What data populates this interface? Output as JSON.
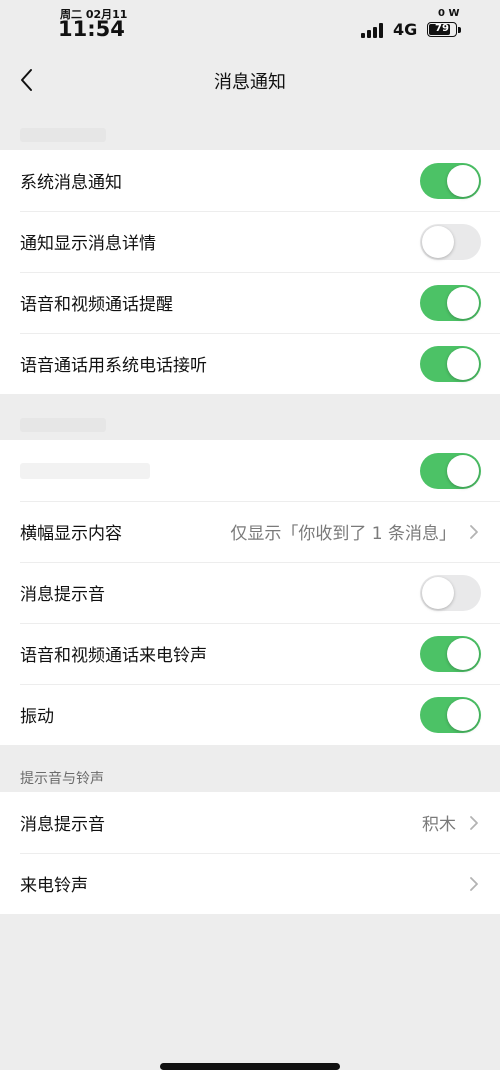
{
  "status_bar": {
    "date": "周二 02月11",
    "time": "11:54",
    "network": "4G",
    "battery": "79",
    "battery_level": 0.79,
    "power": "0 W"
  },
  "header": {
    "title": "消息通知"
  },
  "group1": {
    "rows": [
      {
        "label": "系统消息通知",
        "toggle_on": true
      },
      {
        "label": "通知显示消息详情",
        "toggle_on": false
      },
      {
        "label": "语音和视频通话提醒",
        "toggle_on": true
      },
      {
        "label": "语音通话用系统电话接听",
        "toggle_on": true
      }
    ]
  },
  "group2": {
    "rows": [
      {
        "label": "",
        "toggle_on": true
      },
      {
        "label": "横幅显示内容",
        "value": "仅显示「你收到了 1 条消息」"
      },
      {
        "label": "消息提示音",
        "toggle_on": false
      },
      {
        "label": "语音和视频通话来电铃声",
        "toggle_on": true
      },
      {
        "label": "振动",
        "toggle_on": true
      }
    ]
  },
  "group3": {
    "section_title": "提示音与铃声",
    "rows": [
      {
        "label": "消息提示音",
        "value": "积木"
      },
      {
        "label": "来电铃声",
        "value": ""
      }
    ]
  },
  "colors": {
    "toggle_on": "#4cc266",
    "toggle_off": "#e9e9ea",
    "background": "#ededed"
  }
}
